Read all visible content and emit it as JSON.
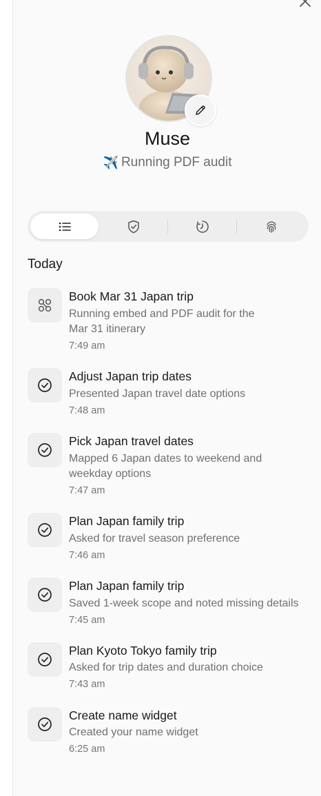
{
  "profile": {
    "name": "Muse",
    "status_emoji": "✈️",
    "status": "Running PDF audit"
  },
  "icons": {
    "close": "close-icon",
    "edit": "pencil-icon",
    "status": "airplane-icon",
    "tabs": [
      "list-icon",
      "shield-check-icon",
      "clock-icon",
      "fingerprint-icon"
    ],
    "running": "nodes-icon",
    "done": "check-circle-icon"
  },
  "section_title": "Today",
  "activities": [
    {
      "title": "Book Mar 31 Japan trip",
      "desc": "Running embed and PDF audit for the Mar 31 itinerary",
      "time": "7:49 am",
      "state": "running"
    },
    {
      "title": "Adjust Japan trip dates",
      "desc": "Presented Japan travel date options",
      "time": "7:48 am",
      "state": "done"
    },
    {
      "title": "Pick Japan travel dates",
      "desc": "Mapped 6 Japan dates to weekend and weekday options",
      "time": "7:47 am",
      "state": "done"
    },
    {
      "title": "Plan Japan family trip",
      "desc": "Asked for travel season preference",
      "time": "7:46 am",
      "state": "done"
    },
    {
      "title": "Plan Japan family trip",
      "desc": "Saved 1-week scope and noted missing details",
      "time": "7:45 am",
      "state": "done"
    },
    {
      "title": "Plan Kyoto Tokyo family trip",
      "desc": "Asked for trip dates and duration choice",
      "time": "7:43 am",
      "state": "done"
    },
    {
      "title": "Create name widget",
      "desc": "Created your name widget",
      "time": "6:25 am",
      "state": "done"
    }
  ]
}
